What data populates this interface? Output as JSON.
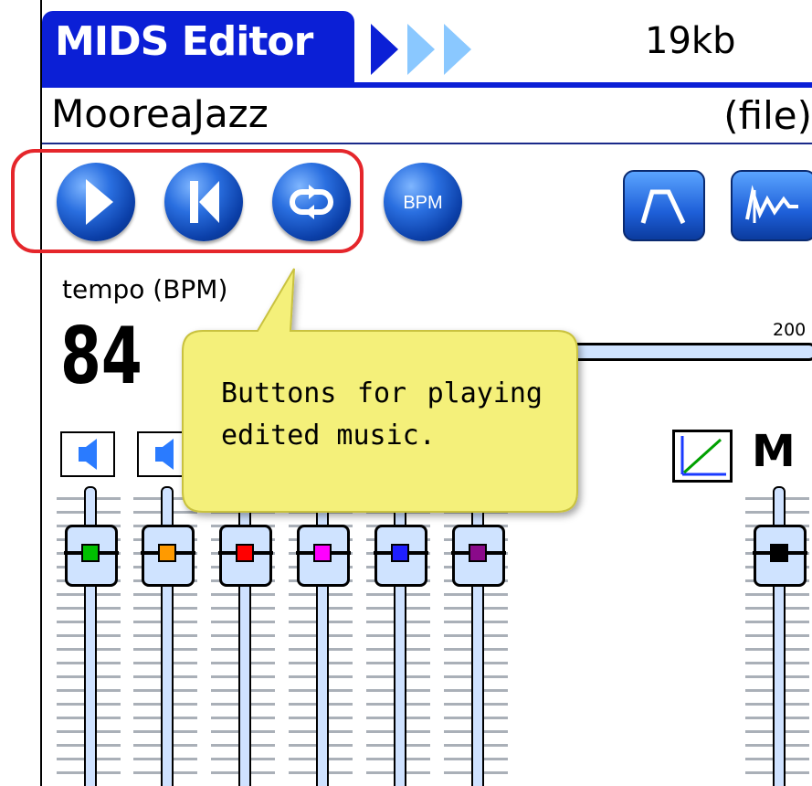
{
  "app": {
    "title": "MIDS Editor",
    "size": "19kb"
  },
  "file": {
    "name": "MooreaJazz",
    "label": "(file)"
  },
  "toolbar": {
    "play_icon": "play-icon",
    "rewind_icon": "skip-to-start-icon",
    "loop_icon": "loop-icon",
    "bpm_label": "BPM",
    "envelope_icon": "envelope-icon",
    "waveform_icon": "waveform-icon"
  },
  "tempo": {
    "label": "tempo (BPM)",
    "value": "84",
    "max_label": "200"
  },
  "mixer": {
    "master_label": "M",
    "channel_colors": [
      "#00c000",
      "#ff9a00",
      "#ff0000",
      "#ff00ff",
      "#1f1fff",
      "#8a0a8a"
    ],
    "master_color": "#000000"
  },
  "tooltip": {
    "text": "Buttons for playing edited music."
  },
  "colors": {
    "title_blue": "#0b1fd6",
    "highlight_red": "#e5262b",
    "tooltip_yellow": "#f4f07a"
  }
}
